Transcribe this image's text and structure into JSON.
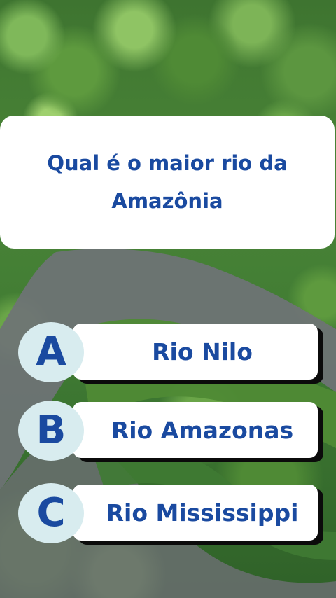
{
  "quiz": {
    "question": "Qual é o maior rio da Amazônia",
    "answers": [
      {
        "letter": "A",
        "text": "Rio Nilo"
      },
      {
        "letter": "B",
        "text": "Rio Amazonas"
      },
      {
        "letter": "C",
        "text": "Rio Mississippi"
      }
    ]
  },
  "colors": {
    "text_blue": "#1a4aa0",
    "card_white": "#ffffff",
    "letter_circle": "#d8ecef",
    "forest_green": "#4a8537",
    "river_gray": "#6f7376"
  }
}
